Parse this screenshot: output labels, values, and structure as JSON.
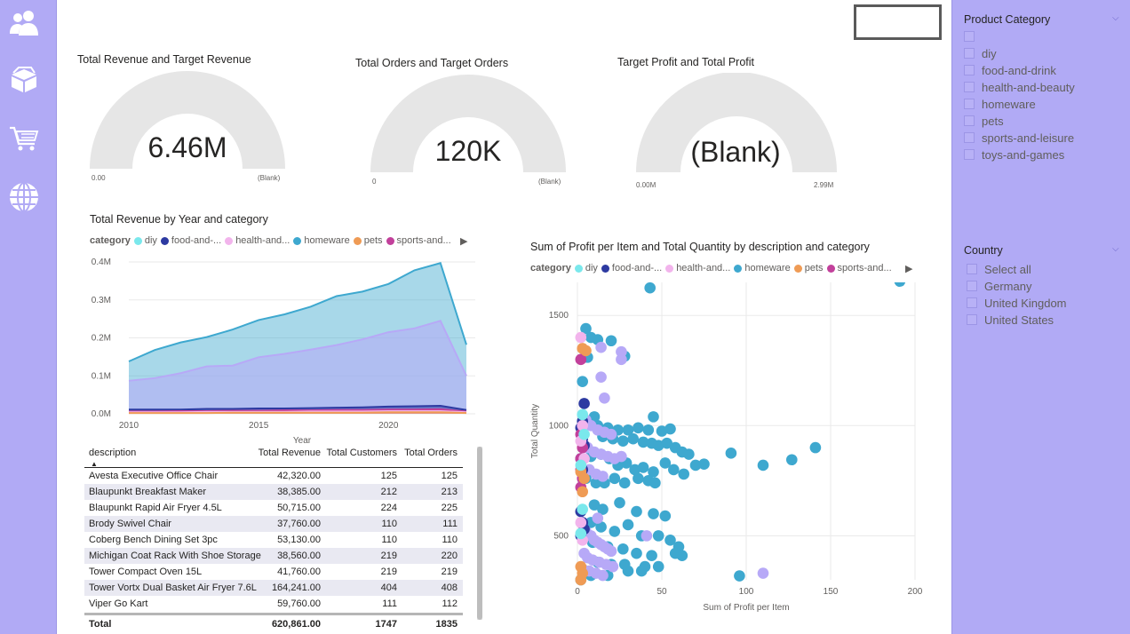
{
  "nav": {
    "icons": [
      "people-icon",
      "box-icon",
      "cart-icon",
      "globe-icon"
    ]
  },
  "gauges": [
    {
      "title": "Total Revenue and Target Revenue",
      "value": "6.46M",
      "min": "0.00",
      "max": "(Blank)",
      "fill_fraction": 0
    },
    {
      "title": "Total Orders and Target Orders",
      "value": "120K",
      "min": "0",
      "max": "(Blank)",
      "fill_fraction": 0
    },
    {
      "title": "Target Profit and Total Profit",
      "value": "(Blank)",
      "min": "0.00M",
      "max": "2.99M",
      "fill_fraction": 0
    }
  ],
  "area_chart": {
    "title": "Total Revenue by Year and category",
    "legend_title": "category",
    "legend": [
      "diy",
      "food-and-...",
      "health-and...",
      "homeware",
      "pets",
      "sports-and..."
    ]
  },
  "scatter_chart": {
    "title": "Sum of Profit per Item and Total Quantity by description and category",
    "legend_title": "category",
    "legend": [
      "diy",
      "food-and-...",
      "health-and...",
      "homeware",
      "pets",
      "sports-and..."
    ]
  },
  "colors": {
    "diy": "#7ae8ec",
    "food-and-drink": "#2d3aa1",
    "health-and-beauty": "#f2b4ec",
    "homeware": "#3ea8cf",
    "pets": "#ef9b55",
    "sports-and-leisure": "#c2409b",
    "toys-and-games": "#b7a9f7",
    "panel": "#b1aaf5"
  },
  "chart_data": [
    {
      "type": "area",
      "title": "Total Revenue by Year and category",
      "xlabel": "Year",
      "ylabel": "",
      "x_ticks": [
        "2010",
        "2015",
        "2020"
      ],
      "y_ticks": [
        "0.0M",
        "0.1M",
        "0.2M",
        "0.3M",
        "0.4M"
      ],
      "xlim": [
        2010,
        2023
      ],
      "ylim": [
        0,
        0.4
      ],
      "x": [
        2010,
        2011,
        2012,
        2013,
        2014,
        2015,
        2016,
        2017,
        2018,
        2019,
        2020,
        2021,
        2022,
        2023
      ],
      "series": [
        {
          "name": "homeware",
          "values": [
            0.138,
            0.168,
            0.188,
            0.202,
            0.222,
            0.247,
            0.262,
            0.282,
            0.31,
            0.322,
            0.342,
            0.378,
            0.397,
            0.182
          ]
        },
        {
          "name": "toys-and-games",
          "values": [
            0.087,
            0.094,
            0.107,
            0.125,
            0.127,
            0.149,
            0.158,
            0.169,
            0.181,
            0.196,
            0.215,
            0.225,
            0.245,
            0.1
          ]
        },
        {
          "name": "food-and-drink",
          "values": [
            0.011,
            0.011,
            0.011,
            0.013,
            0.013,
            0.014,
            0.014,
            0.015,
            0.016,
            0.017,
            0.019,
            0.02,
            0.021,
            0.01
          ]
        },
        {
          "name": "sports-and-leisure",
          "values": [
            0.006,
            0.006,
            0.007,
            0.007,
            0.008,
            0.008,
            0.009,
            0.009,
            0.01,
            0.01,
            0.011,
            0.011,
            0.012,
            0.006
          ]
        },
        {
          "name": "health-and-beauty",
          "values": [
            0.004,
            0.004,
            0.004,
            0.005,
            0.005,
            0.005,
            0.005,
            0.006,
            0.006,
            0.006,
            0.007,
            0.007,
            0.007,
            0.004
          ]
        },
        {
          "name": "pets",
          "values": [
            0.002,
            0.002,
            0.002,
            0.002,
            0.003,
            0.003,
            0.003,
            0.003,
            0.003,
            0.003,
            0.004,
            0.004,
            0.004,
            0.002
          ]
        }
      ]
    },
    {
      "type": "scatter",
      "title": "Sum of Profit per Item and Total Quantity by description and category",
      "xlabel": "Sum of Profit per Item",
      "ylabel": "Total Quantity",
      "x_ticks": [
        "0",
        "50",
        "100",
        "150",
        "200"
      ],
      "y_ticks": [
        "500",
        "1000",
        "1500"
      ],
      "xlim": [
        0,
        200
      ],
      "ylim": [
        300,
        1650
      ],
      "series": [
        {
          "name": "homeware",
          "points": [
            [
              43,
              1625
            ],
            [
              191,
              1655
            ],
            [
              5,
              1440
            ],
            [
              8,
              1400
            ],
            [
              12,
              1390
            ],
            [
              20,
              1385
            ],
            [
              28,
              1315
            ],
            [
              6,
              1310
            ],
            [
              3,
              1200
            ],
            [
              10,
              1040
            ],
            [
              45,
              1040
            ],
            [
              12,
              1000
            ],
            [
              18,
              990
            ],
            [
              24,
              980
            ],
            [
              30,
              980
            ],
            [
              36,
              990
            ],
            [
              42,
              980
            ],
            [
              50,
              975
            ],
            [
              55,
              985
            ],
            [
              15,
              950
            ],
            [
              21,
              940
            ],
            [
              27,
              930
            ],
            [
              33,
              940
            ],
            [
              39,
              925
            ],
            [
              44,
              920
            ],
            [
              48,
              910
            ],
            [
              53,
              920
            ],
            [
              58,
              900
            ],
            [
              62,
              880
            ],
            [
              66,
              870
            ],
            [
              70,
              820
            ],
            [
              75,
              825
            ],
            [
              91,
              875
            ],
            [
              110,
              820
            ],
            [
              127,
              845
            ],
            [
              141,
              900
            ],
            [
              8,
              860
            ],
            [
              14,
              870
            ],
            [
              19,
              850
            ],
            [
              24,
              820
            ],
            [
              29,
              830
            ],
            [
              34,
              800
            ],
            [
              39,
              810
            ],
            [
              45,
              790
            ],
            [
              52,
              830
            ],
            [
              57,
              800
            ],
            [
              63,
              780
            ],
            [
              5,
              760
            ],
            [
              11,
              740
            ],
            [
              16,
              740
            ],
            [
              22,
              760
            ],
            [
              28,
              740
            ],
            [
              36,
              760
            ],
            [
              42,
              750
            ],
            [
              46,
              740
            ],
            [
              10,
              640
            ],
            [
              15,
              620
            ],
            [
              25,
              650
            ],
            [
              35,
              610
            ],
            [
              45,
              600
            ],
            [
              52,
              590
            ],
            [
              8,
              560
            ],
            [
              14,
              540
            ],
            [
              22,
              520
            ],
            [
              30,
              550
            ],
            [
              38,
              500
            ],
            [
              48,
              500
            ],
            [
              55,
              480
            ],
            [
              60,
              450
            ],
            [
              9,
              470
            ],
            [
              18,
              450
            ],
            [
              27,
              440
            ],
            [
              35,
              420
            ],
            [
              44,
              410
            ],
            [
              58,
              420
            ],
            [
              62,
              410
            ],
            [
              12,
              380
            ],
            [
              20,
              370
            ],
            [
              28,
              370
            ],
            [
              40,
              360
            ],
            [
              48,
              360
            ],
            [
              30,
              340
            ],
            [
              38,
              340
            ],
            [
              18,
              320
            ],
            [
              8,
              320
            ],
            [
              96,
              318
            ],
            [
              2,
              300
            ]
          ]
        },
        {
          "name": "toys-and-games",
          "points": [
            [
              14,
              1355
            ],
            [
              26,
              1335
            ],
            [
              26,
              1300
            ],
            [
              14,
              1220
            ],
            [
              16,
              1125
            ],
            [
              5,
              1025
            ],
            [
              8,
              1000
            ],
            [
              12,
              980
            ],
            [
              16,
              970
            ],
            [
              20,
              960
            ],
            [
              6,
              900
            ],
            [
              10,
              880
            ],
            [
              14,
              870
            ],
            [
              18,
              860
            ],
            [
              22,
              850
            ],
            [
              26,
              860
            ],
            [
              7,
              800
            ],
            [
              11,
              780
            ],
            [
              15,
              770
            ],
            [
              12,
              580
            ],
            [
              5,
              520
            ],
            [
              8,
              500
            ],
            [
              10,
              480
            ],
            [
              12,
              470
            ],
            [
              14,
              460
            ],
            [
              16,
              450
            ],
            [
              18,
              440
            ],
            [
              20,
              430
            ],
            [
              4,
              420
            ],
            [
              6,
              400
            ],
            [
              9,
              390
            ],
            [
              13,
              380
            ],
            [
              17,
              370
            ],
            [
              21,
              360
            ],
            [
              3,
              350
            ],
            [
              7,
              340
            ],
            [
              11,
              330
            ],
            [
              15,
              320
            ],
            [
              41,
              500
            ],
            [
              110,
              330
            ]
          ]
        },
        {
          "name": "food-and-drink",
          "points": [
            [
              4,
              1100
            ],
            [
              3,
              1020
            ],
            [
              2,
              990
            ],
            [
              3,
              940
            ],
            [
              4,
              910
            ],
            [
              2,
              850
            ],
            [
              3,
              800
            ],
            [
              2,
              610
            ],
            [
              3,
              560
            ],
            [
              4,
              530
            ],
            [
              2,
              500
            ]
          ]
        },
        {
          "name": "sports-and-leisure",
          "points": [
            [
              2,
              1300
            ],
            [
              2,
              960
            ],
            [
              3,
              900
            ],
            [
              2,
              850
            ],
            [
              2,
              800
            ],
            [
              3,
              760
            ],
            [
              2,
              720
            ]
          ]
        },
        {
          "name": "pets",
          "points": [
            [
              3,
              1350
            ],
            [
              5,
              1340
            ],
            [
              2,
              790
            ],
            [
              4,
              760
            ],
            [
              3,
              700
            ],
            [
              2,
              360
            ],
            [
              3,
              330
            ],
            [
              2,
              300
            ]
          ]
        },
        {
          "name": "health-and-beauty",
          "points": [
            [
              2,
              1400
            ],
            [
              3,
              1000
            ],
            [
              2,
              930
            ],
            [
              4,
              850
            ],
            [
              2,
              560
            ],
            [
              3,
              480
            ]
          ]
        },
        {
          "name": "diy",
          "points": [
            [
              3,
              1050
            ],
            [
              4,
              960
            ],
            [
              2,
              820
            ],
            [
              3,
              620
            ],
            [
              2,
              510
            ]
          ]
        }
      ]
    }
  ],
  "table": {
    "headers": {
      "description": "description",
      "revenue": "Total Revenue",
      "customers": "Total Customers",
      "orders": "Total Orders"
    },
    "rows": [
      {
        "description": "Avesta Executive Office Chair",
        "revenue": "42,320.00",
        "customers": "125",
        "orders": "125"
      },
      {
        "description": "Blaupunkt Breakfast Maker",
        "revenue": "38,385.00",
        "customers": "212",
        "orders": "213"
      },
      {
        "description": "Blaupunkt Rapid Air Fryer 4.5L",
        "revenue": "50,715.00",
        "customers": "224",
        "orders": "225"
      },
      {
        "description": "Brody Swivel Chair",
        "revenue": "37,760.00",
        "customers": "110",
        "orders": "111"
      },
      {
        "description": "Coberg Bench Dining Set 3pc",
        "revenue": "53,130.00",
        "customers": "110",
        "orders": "110"
      },
      {
        "description": "Michigan Coat Rack With Shoe Storage",
        "revenue": "38,560.00",
        "customers": "219",
        "orders": "220"
      },
      {
        "description": "Tower Compact Oven 15L",
        "revenue": "41,760.00",
        "customers": "219",
        "orders": "219"
      },
      {
        "description": "Tower Vortx Dual Basket Air Fryer 7.6L",
        "revenue": "164,241.00",
        "customers": "404",
        "orders": "408"
      },
      {
        "description": "Viper Go Kart",
        "revenue": "59,760.00",
        "customers": "111",
        "orders": "112"
      }
    ],
    "total": {
      "label": "Total",
      "revenue": "620,861.00",
      "customers": "1747",
      "orders": "1835"
    }
  },
  "slicers": {
    "product_category": {
      "title": "Product Category",
      "items": [
        "",
        "diy",
        "food-and-drink",
        "health-and-beauty",
        "homeware",
        "pets",
        "sports-and-leisure",
        "toys-and-games"
      ]
    },
    "country": {
      "title": "Country",
      "items": [
        "Select all",
        "Germany",
        "United Kingdom",
        "United States"
      ]
    }
  }
}
